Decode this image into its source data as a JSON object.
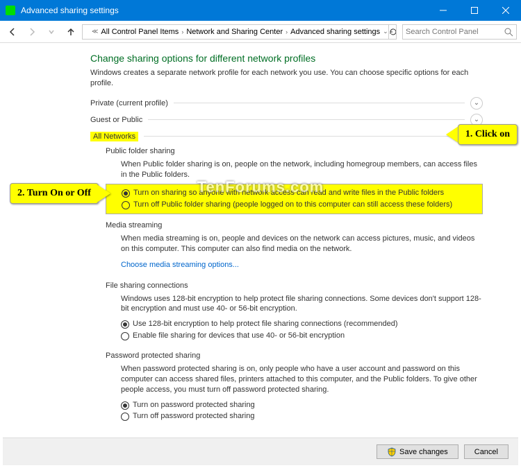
{
  "window": {
    "title": "Advanced sharing settings"
  },
  "nav": {
    "crumbs": [
      "All Control Panel Items",
      "Network and Sharing Center",
      "Advanced sharing settings"
    ],
    "search_placeholder": "Search Control Panel"
  },
  "page": {
    "heading": "Change sharing options for different network profiles",
    "intro": "Windows creates a separate network profile for each network you use. You can choose specific options for each profile."
  },
  "sections": {
    "private": {
      "title": "Private (current profile)"
    },
    "guest": {
      "title": "Guest or Public"
    },
    "all": {
      "title": "All Networks"
    }
  },
  "public_folder": {
    "title": "Public folder sharing",
    "desc": "When Public folder sharing is on, people on the network, including homegroup members, can access files in the Public folders.",
    "opt_on": "Turn on sharing so anyone with network access can read and write files in the Public folders",
    "opt_off": "Turn off Public folder sharing (people logged on to this computer can still access these folders)"
  },
  "media": {
    "title": "Media streaming",
    "desc": "When media streaming is on, people and devices on the network can access pictures, music, and videos on this computer. This computer can also find media on the network.",
    "link": "Choose media streaming options..."
  },
  "file_conn": {
    "title": "File sharing connections",
    "desc": "Windows uses 128-bit encryption to help protect file sharing connections. Some devices don't support 128-bit encryption and must use 40- or 56-bit encryption.",
    "opt_128": "Use 128-bit encryption to help protect file sharing connections (recommended)",
    "opt_40": "Enable file sharing for devices that use 40- or 56-bit encryption"
  },
  "password": {
    "title": "Password protected sharing",
    "desc": "When password protected sharing is on, only people who have a user account and password on this computer can access shared files, printers attached to this computer, and the Public folders. To give other people access, you must turn off password protected sharing.",
    "opt_on": "Turn on password protected sharing",
    "opt_off": "Turn off password protected sharing"
  },
  "footer": {
    "save": "Save changes",
    "cancel": "Cancel"
  },
  "callouts": {
    "c1": "1. Click on",
    "c2": "2. Turn On or Off"
  },
  "watermark": "TenForums.com"
}
